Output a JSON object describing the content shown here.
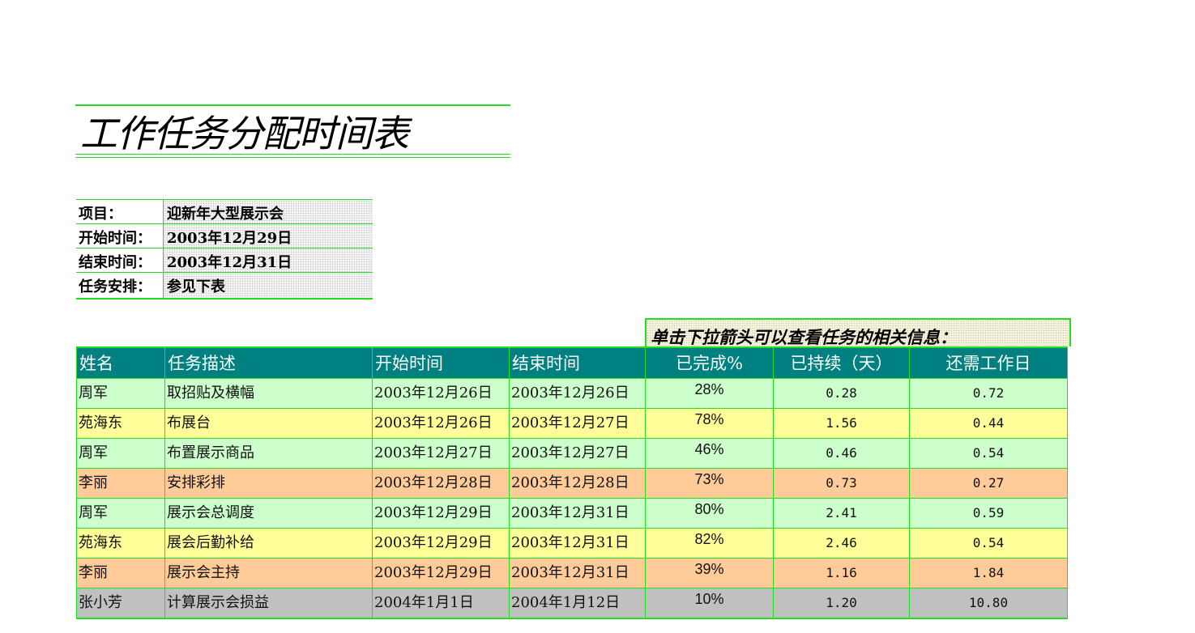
{
  "title": "工作任务分配时间表",
  "info": [
    {
      "label": "项目：",
      "value": "迎新年大型展示会"
    },
    {
      "label": "开始时间：",
      "value": "2003年12月29日"
    },
    {
      "label": "结束时间：",
      "value": "2003年12月31日"
    },
    {
      "label": "任务安排：",
      "value": "参见下表"
    }
  ],
  "hint": "单击下拉箭头可以查看任务的相关信息：",
  "headers": [
    "姓名",
    "任务描述",
    "开始时间",
    "结束时间",
    "已完成%",
    "已持续（天）",
    "还需工作日"
  ],
  "colors": {
    "header_bg": "#008080",
    "border": "#22dd22",
    "row_green": "#ccffcc",
    "row_yellow": "#ffff99",
    "row_orange": "#ffcc99",
    "row_gray": "#c0c0c0"
  },
  "rows": [
    {
      "name": "周军",
      "task": "取招贴及横幅",
      "start": "2003年12月26日",
      "end": "2003年12月26日",
      "done": "28%",
      "elapsed": "0.28",
      "remaining": "0.72",
      "color": "#ccffcc"
    },
    {
      "name": "苑海东",
      "task": "布展台",
      "start": "2003年12月26日",
      "end": "2003年12月27日",
      "done": "78%",
      "elapsed": "1.56",
      "remaining": "0.44",
      "color": "#ffff99"
    },
    {
      "name": "周军",
      "task": "布置展示商品",
      "start": "2003年12月27日",
      "end": "2003年12月27日",
      "done": "46%",
      "elapsed": "0.46",
      "remaining": "0.54",
      "color": "#ccffcc"
    },
    {
      "name": "李丽",
      "task": "安排彩排",
      "start": "2003年12月28日",
      "end": "2003年12月28日",
      "done": "73%",
      "elapsed": "0.73",
      "remaining": "0.27",
      "color": "#ffcc99"
    },
    {
      "name": "周军",
      "task": "展示会总调度",
      "start": "2003年12月29日",
      "end": "2003年12月31日",
      "done": "80%",
      "elapsed": "2.41",
      "remaining": "0.59",
      "color": "#ccffcc"
    },
    {
      "name": "苑海东",
      "task": "展会后勤补给",
      "start": "2003年12月29日",
      "end": "2003年12月31日",
      "done": "82%",
      "elapsed": "2.46",
      "remaining": "0.54",
      "color": "#ffff99"
    },
    {
      "name": "李丽",
      "task": "展示会主持",
      "start": "2003年12月29日",
      "end": "2003年12月31日",
      "done": "39%",
      "elapsed": "1.16",
      "remaining": "1.84",
      "color": "#ffcc99"
    },
    {
      "name": "张小芳",
      "task": "计算展示会损益",
      "start": "2004年1月1日",
      "end": "2004年1月12日",
      "done": "10%",
      "elapsed": "1.20",
      "remaining": "10.80",
      "color": "#c0c0c0"
    }
  ]
}
